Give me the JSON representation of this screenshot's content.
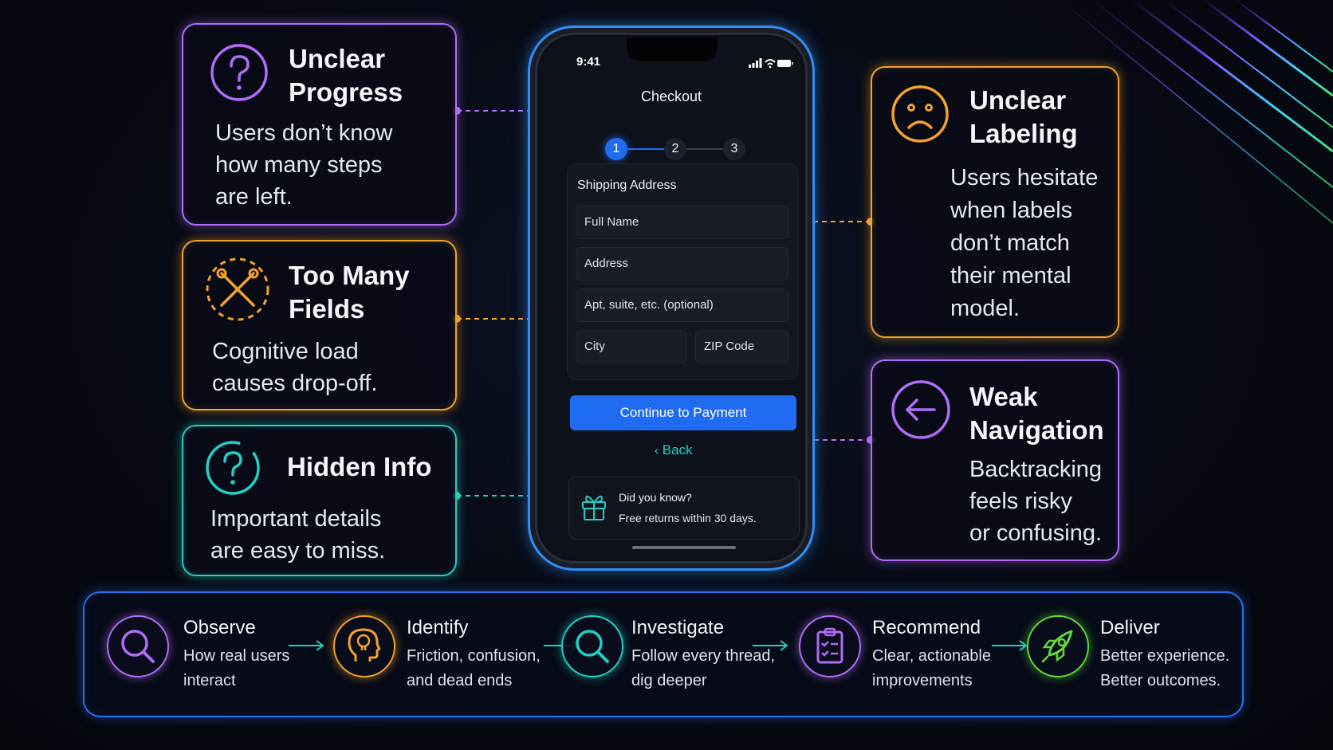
{
  "callouts": {
    "unclear_progress": {
      "title_line1": "Unclear",
      "title_line2": "Progress",
      "body_line1": "Users don’t know",
      "body_line2": "how many steps",
      "body_line3": "are left.",
      "icon": "question-circle-icon"
    },
    "too_many_fields": {
      "title_line1": "Too Many",
      "title_line2": "Fields",
      "body_line1": "Cognitive load",
      "body_line2": "causes drop-off.",
      "icon": "crossed-tools-icon"
    },
    "hidden_info": {
      "title": "Hidden Info",
      "body_line1": "Important details",
      "body_line2": "are easy to miss.",
      "icon": "question-circle-icon"
    },
    "unclear_labeling": {
      "title_line1": "Unclear",
      "title_line2": "Labeling",
      "body_line1": "Users hesitate",
      "body_line2": "when labels",
      "body_line3": "don’t match",
      "body_line4": "their mental",
      "body_line5": "model.",
      "icon": "sad-face-icon"
    },
    "weak_navigation": {
      "title_line1": "Weak",
      "title_line2": "Navigation",
      "body_line1": "Backtracking",
      "body_line2": "feels risky",
      "body_line3": "or confusing.",
      "icon": "back-arrow-circle-icon"
    }
  },
  "phone": {
    "time": "9:41",
    "title": "Checkout",
    "steps": [
      "1",
      "2",
      "3"
    ],
    "active_step": 1,
    "form": {
      "heading": "Shipping Address",
      "full_name": "Full Name",
      "address": "Address",
      "apt": "Apt, suite, etc. (optional)",
      "city": "City",
      "zip": "ZIP Code"
    },
    "cta": "Continue to Payment",
    "back": "Back",
    "tip": {
      "title": "Did you know?",
      "body": "Free returns within 30 days."
    }
  },
  "process": [
    {
      "title": "Observe",
      "desc_line1": "How real users",
      "desc_line2": "interact",
      "icon": "magnifier-icon",
      "color": "#b06cf5"
    },
    {
      "title": "Identify",
      "desc_line1": "Friction, confusion,",
      "desc_line2": "and dead ends",
      "icon": "head-lightbulb-icon",
      "color": "#f2a12b"
    },
    {
      "title": "Investigate",
      "desc_line1": "Follow every thread,",
      "desc_line2": "dig deeper",
      "icon": "magnifier-icon",
      "color": "#22cfc4"
    },
    {
      "title": "Recommend",
      "desc_line1": "Clear, actionable",
      "desc_line2": "improvements",
      "icon": "clipboard-check-icon",
      "color": "#b06cf5"
    },
    {
      "title": "Deliver",
      "desc_line1": "Better experience.",
      "desc_line2": "Better outcomes.",
      "icon": "rocket-icon",
      "color": "#5fd83a"
    }
  ],
  "colors": {
    "purple": "#b06cf5",
    "orange": "#f2a12b",
    "teal": "#22cfc4",
    "blue": "#1f6cf2",
    "green": "#5fd83a"
  }
}
